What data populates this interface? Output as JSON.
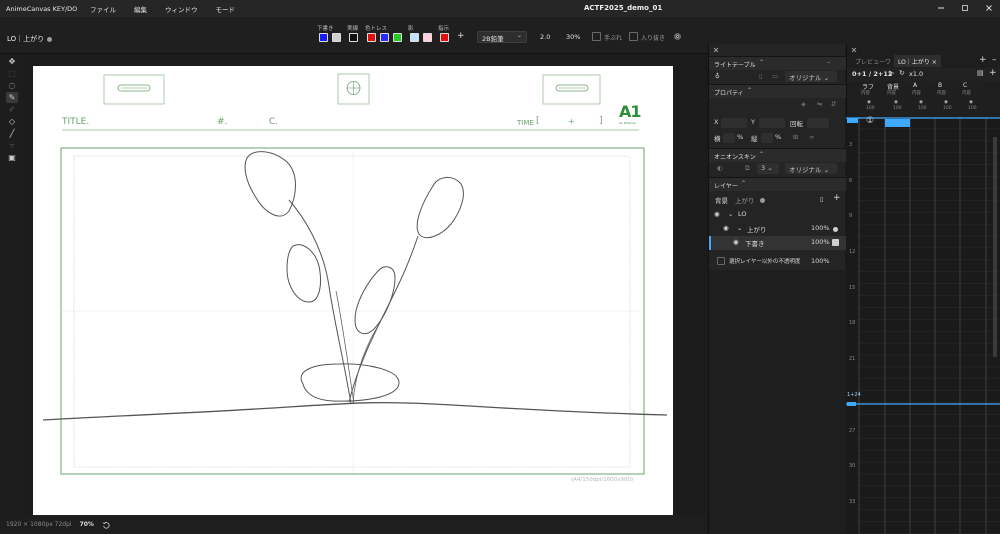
{
  "app": {
    "name": "AnimeCanvas KEY/DO",
    "menus": [
      "ファイル",
      "編集",
      "ウィンドウ",
      "モード"
    ],
    "document_title": "ACTF2025_demo_01"
  },
  "toolbar": {
    "layer_label": "LO｜上がり",
    "color_groups": [
      {
        "label": "下書き",
        "colors": [
          "#1a1aff",
          "#cfcfcf"
        ]
      },
      {
        "label": "実線",
        "colors": [
          "#111111"
        ]
      },
      {
        "label": "色トレス",
        "colors": [
          "#e01010",
          "#2b2bff",
          "#22cc22"
        ]
      },
      {
        "label": "影",
        "colors": [
          "#bfe3ff",
          "#ffcfe0"
        ]
      },
      {
        "label": "指示",
        "colors": [
          "#e01010"
        ]
      }
    ],
    "add_label": "+",
    "pencil_select": "2B鉛筆",
    "brush_size": "2.0",
    "brush_opacity": "30%",
    "stabilizer_label": "手ぶれ",
    "pressure_label": "入り抜き"
  },
  "canvas": {
    "title_label": "TITLE.",
    "number_label": "#.",
    "cut_label": "C.",
    "time_label": "TIME",
    "time_bracket_open": "[",
    "time_plus": "+",
    "time_bracket_close": "]",
    "logo_text": "A1",
    "logo_sub": "A1 Pictures",
    "paper_info": "(A4/150dpi/1600x900)",
    "resolution": "1920 × 1080px 72dpi",
    "zoom": "70%"
  },
  "panels": {
    "light_table": {
      "title": "ライトテーブル",
      "dropdown": "オリジナル"
    },
    "property": {
      "title": "プロパティ",
      "x_label": "X",
      "y_label": "Y",
      "rotate_label": "回転",
      "width_label": "横",
      "width_unit": "%",
      "height_label": "縦",
      "height_unit": "%"
    },
    "onion": {
      "title": "オニオンスキン",
      "count": "3",
      "dropdown": "オリジナル"
    },
    "layers": {
      "title": "レイヤー",
      "bg_label": "背景",
      "bg_sub": "上がり",
      "items": [
        {
          "name": "LO",
          "opacity": ""
        },
        {
          "name": "上がり",
          "opacity": "100%"
        },
        {
          "name": "下書き",
          "opacity": "100%"
        }
      ],
      "non_selected_opacity_label": "選択レイヤー以外の不透明度",
      "non_selected_opacity": "100%"
    }
  },
  "timesheet": {
    "tab_preview": "プレビューワ",
    "tab_active": "LO｜上がり",
    "frame_readout": "0+1 / 2+12",
    "speed": "x1.0",
    "columns": [
      {
        "name": "ラフ",
        "sub": "内容",
        "val": "100"
      },
      {
        "name": "背景",
        "sub": "内容",
        "val": "100"
      },
      {
        "name": "A",
        "sub": "内容",
        "val": "100"
      },
      {
        "name": "B",
        "sub": "内容",
        "val": "100"
      },
      {
        "name": "C",
        "sub": "内容",
        "val": "100"
      }
    ],
    "cell_mark": "①",
    "frame_numbers": [
      "3",
      "6",
      "9",
      "12",
      "15",
      "18",
      "21",
      "1+24",
      "27",
      "30",
      "33"
    ]
  }
}
